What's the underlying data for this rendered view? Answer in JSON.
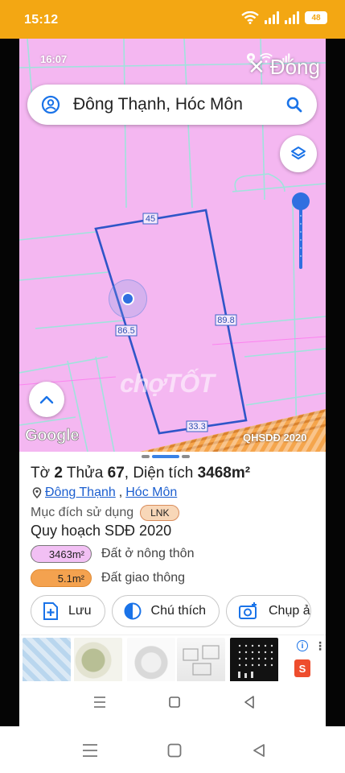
{
  "outer_status": {
    "time": "15:12",
    "battery": "48"
  },
  "inner_status": {
    "time": "16:07"
  },
  "overlay": {
    "close_label": "Đóng"
  },
  "search": {
    "text": "Đông Thạnh, Hóc Môn"
  },
  "map": {
    "edge_labels": [
      "45",
      "86.5",
      "89.8",
      "33.3"
    ],
    "attribution": "Google",
    "layer_label": "QHSDĐ 2020",
    "watermark": "chợTỐT"
  },
  "parcel": {
    "to_label": "Tờ ",
    "to_value": "2",
    "thua_label": " Thửa ",
    "thua_value": "67",
    "area_label": ", Diện tích ",
    "area_value": "3468m²",
    "ward": "Đông Thạnh",
    "separator": ", ",
    "district": "Hóc Môn",
    "purpose_label": "Mục đích sử dụng",
    "purpose_code": "LNK",
    "plan_title": "Quy hoạch SDĐ 2020",
    "plans": [
      {
        "area": "3463m²",
        "label": "Đất ở nông thôn",
        "color": "#f2c0f4"
      },
      {
        "area": "5.1m²",
        "label": "Đất giao thông",
        "color": "#f4a24f"
      }
    ]
  },
  "actions": {
    "save_label": "Lưu",
    "legend_label": "Chú thích",
    "capture_label": "Chụp ả"
  },
  "ads": {
    "info_icon": "i",
    "shop_icon": "S"
  },
  "colors": {
    "map_fill": "#f4b7f1",
    "accent": "#2f6fe0",
    "status_bar": "#f3a713"
  }
}
